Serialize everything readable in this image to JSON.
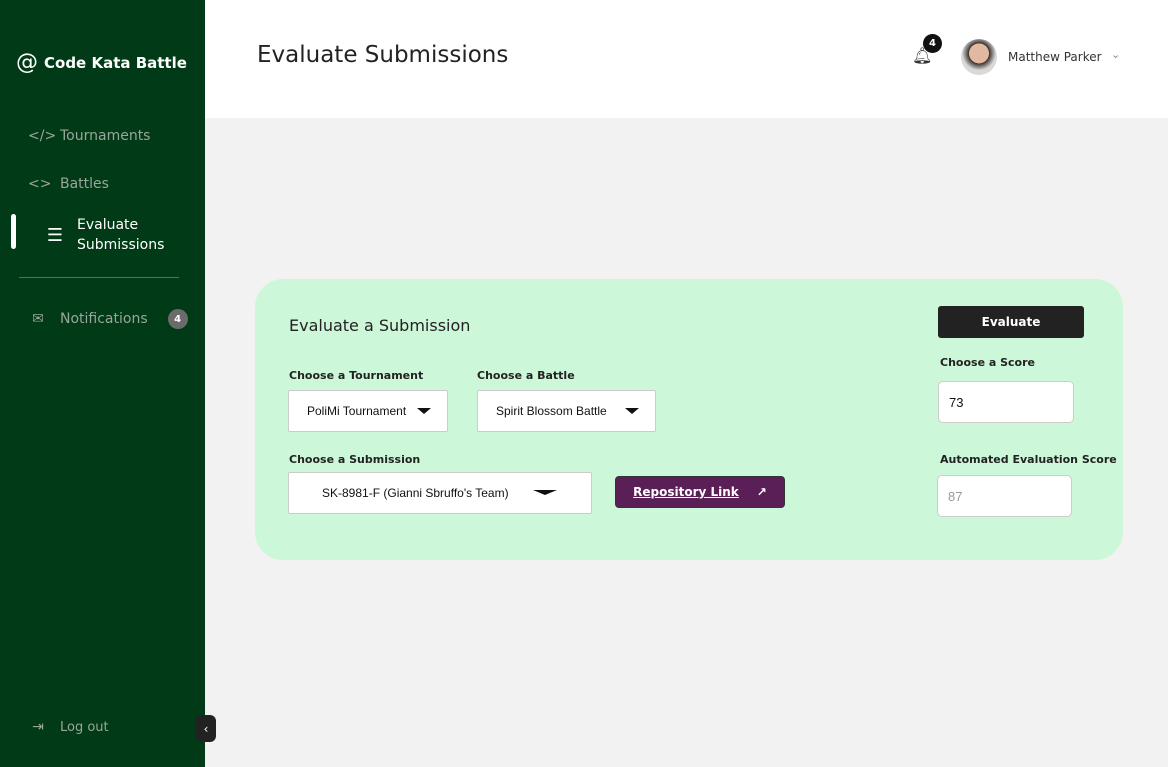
{
  "sidebar": {
    "logo": "Code Kata Battle",
    "logo_icon": "at-icon",
    "items": [
      {
        "label": "Tournaments",
        "icon": "code-slash-icon"
      },
      {
        "label": "Battles",
        "icon": "code-brackets-icon"
      },
      {
        "label": "Evaluate",
        "label2": "Submissions",
        "icon": "numbered-list-icon"
      },
      {
        "label": "Notifications",
        "icon": "mail-icon",
        "badge": "4"
      }
    ],
    "logout": "Log out"
  },
  "header": {
    "title": "Evaluate Submissions",
    "notif_count": "4",
    "user": "Matthew Parker"
  },
  "card": {
    "title": "Evaluate a Submission",
    "evaluate_label": "Evaluate",
    "tournament_label": "Choose a Tournament",
    "tournament_value": "PoliMi Tournament",
    "battle_label": "Choose a Battle",
    "battle_value": "Spirit Blossom Battle",
    "submission_label": "Choose a Submission",
    "submission_value": "SK-8981-F (Gianni Sbruffo's Team)",
    "repo_label": "Repository Link",
    "score_label": "Choose a Score",
    "score_value": "73",
    "auto_label": "Automated Evaluation Score",
    "auto_value": "87"
  },
  "colors": {
    "sidebar": "#013a16",
    "card": "#cdf7d9",
    "repo_button": "#5a1f57"
  }
}
